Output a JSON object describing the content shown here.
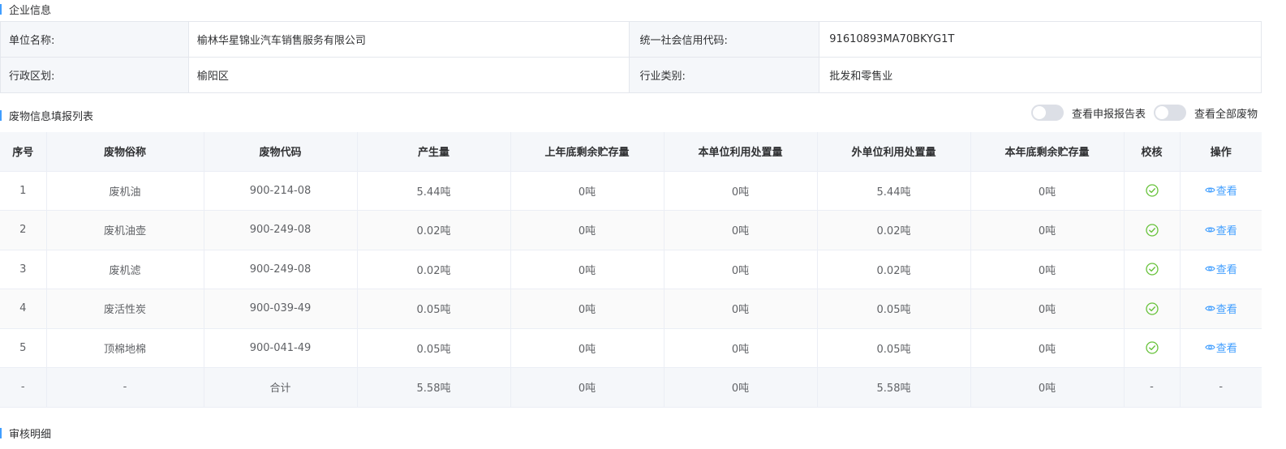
{
  "company": {
    "section_title": "企业信息",
    "unit_name_label": "单位名称:",
    "unit_name_value": "榆林华星锦业汽车销售服务有限公司",
    "credit_code_label": "统一社会信用代码:",
    "credit_code_value": "91610893MA70BKYG1T",
    "district_label": "行政区划:",
    "district_value": "榆阳区",
    "industry_label": "行业类别:",
    "industry_value": "批发和零售业"
  },
  "waste": {
    "section_title": "废物信息填报列表",
    "toggle_report": "查看申报报告表",
    "toggle_all": "查看全部废物",
    "columns": [
      "序号",
      "废物俗称",
      "废物代码",
      "产生量",
      "上年底剩余贮存量",
      "本单位利用处置量",
      "外单位利用处置量",
      "本年底剩余贮存量",
      "校核",
      "操作"
    ],
    "view_label": "查看",
    "rows": [
      {
        "no": "1",
        "name": "废机油",
        "code": "900-214-08",
        "produced": "5.44吨",
        "last_stock": "0吨",
        "self_disposal": "0吨",
        "ext_disposal": "5.44吨",
        "year_stock": "0吨"
      },
      {
        "no": "2",
        "name": "废机油壶",
        "code": "900-249-08",
        "produced": "0.02吨",
        "last_stock": "0吨",
        "self_disposal": "0吨",
        "ext_disposal": "0.02吨",
        "year_stock": "0吨"
      },
      {
        "no": "3",
        "name": "废机滤",
        "code": "900-249-08",
        "produced": "0.02吨",
        "last_stock": "0吨",
        "self_disposal": "0吨",
        "ext_disposal": "0.02吨",
        "year_stock": "0吨"
      },
      {
        "no": "4",
        "name": "废活性炭",
        "code": "900-039-49",
        "produced": "0.05吨",
        "last_stock": "0吨",
        "self_disposal": "0吨",
        "ext_disposal": "0.05吨",
        "year_stock": "0吨"
      },
      {
        "no": "5",
        "name": "顶棉地棉",
        "code": "900-041-49",
        "produced": "0.05吨",
        "last_stock": "0吨",
        "self_disposal": "0吨",
        "ext_disposal": "0.05吨",
        "year_stock": "0吨"
      }
    ],
    "total": {
      "no": "-",
      "name": "-",
      "code": "合计",
      "produced": "5.58吨",
      "last_stock": "0吨",
      "self_disposal": "0吨",
      "ext_disposal": "5.58吨",
      "year_stock": "0吨",
      "check": "-",
      "action": "-"
    }
  },
  "audit": {
    "section_title": "审核明细"
  },
  "colors": {
    "accent": "#409eff",
    "success": "#67c23a"
  }
}
